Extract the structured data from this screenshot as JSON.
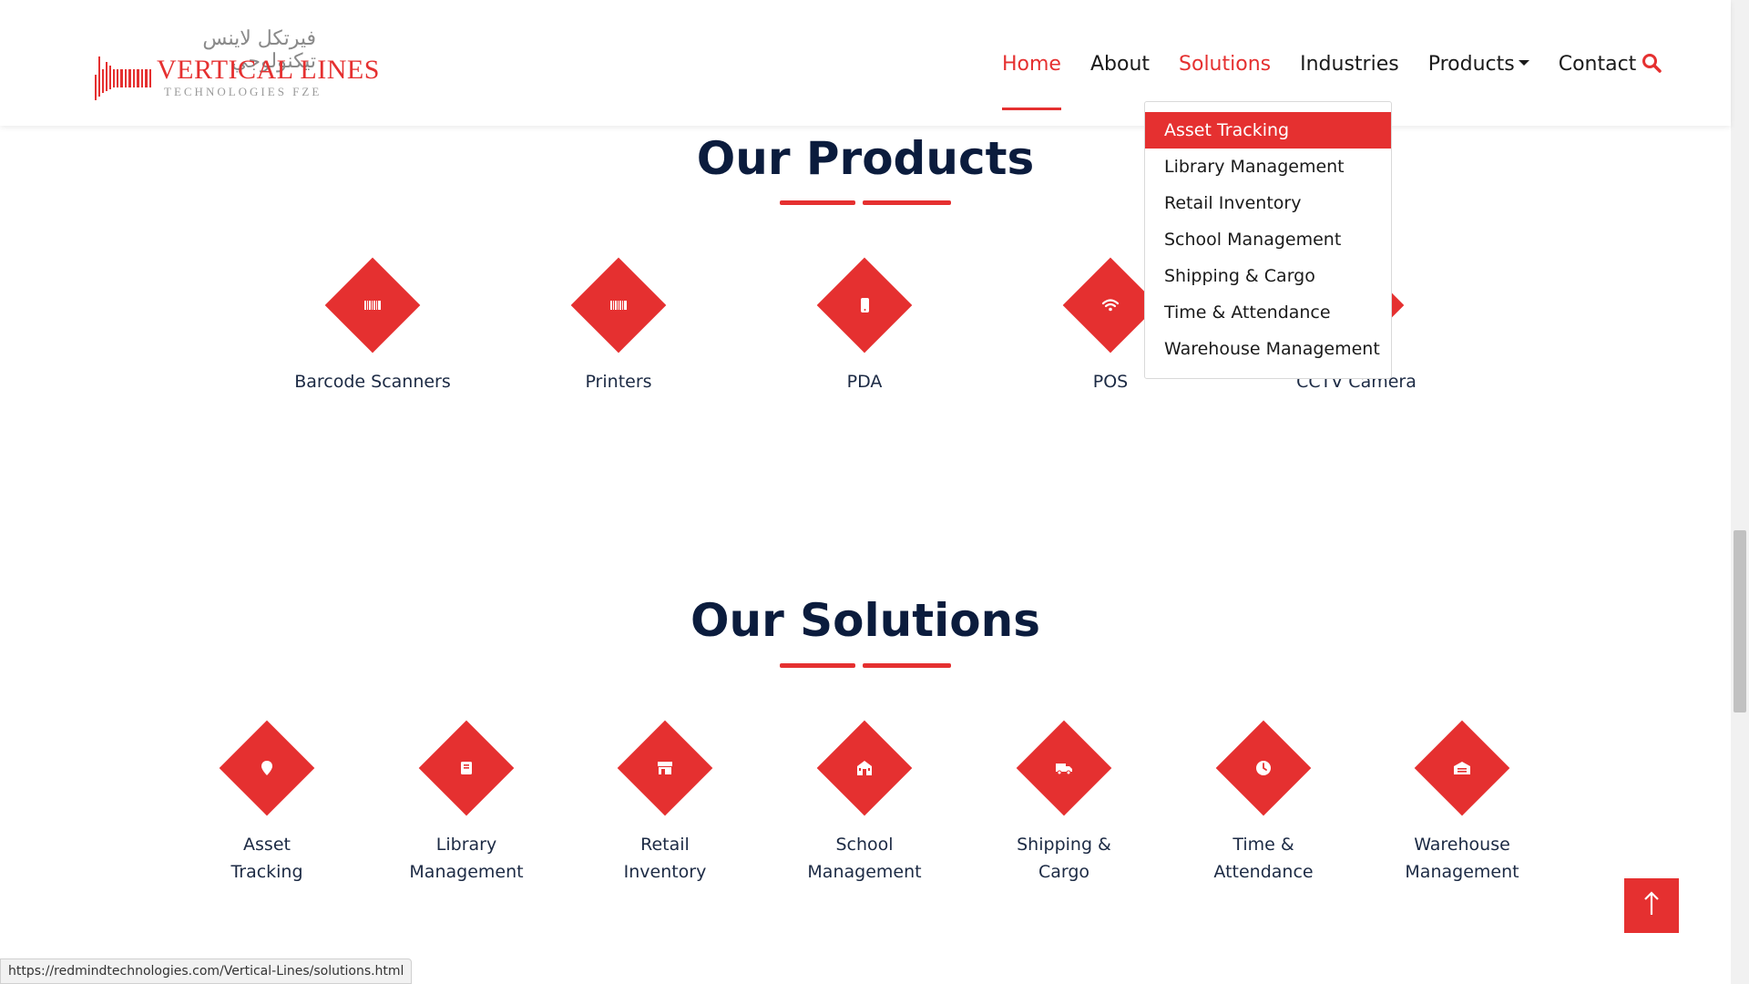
{
  "brand": {
    "arabic": "فيرتكل لاينس تيكنولوجي",
    "name": "VERTICAL LINES",
    "tagline": "TECHNOLOGIES FZE",
    "accent_color": "#e53030",
    "title_color": "#0b1c3d"
  },
  "nav": {
    "items": [
      {
        "label": "Home"
      },
      {
        "label": "About"
      },
      {
        "label": "Solutions"
      },
      {
        "label": "Industries"
      },
      {
        "label": "Products"
      },
      {
        "label": "Contact"
      }
    ],
    "search_icon": "search-icon"
  },
  "solutions_menu": {
    "items": [
      {
        "label": "Asset Tracking"
      },
      {
        "label": "Library Management"
      },
      {
        "label": "Retail Inventory"
      },
      {
        "label": "School Management"
      },
      {
        "label": "Shipping & Cargo"
      },
      {
        "label": "Time & Attendance"
      },
      {
        "label": "Warehouse Management"
      }
    ]
  },
  "products": {
    "title": "Our Products",
    "items": [
      {
        "label": "Barcode Scanners",
        "icon": "barcode-icon"
      },
      {
        "label": "Printers",
        "icon": "barcode-icon"
      },
      {
        "label": "PDA",
        "icon": "mobile-icon"
      },
      {
        "label": "POS",
        "icon": "wifi-icon"
      },
      {
        "label": "CCTV Camera",
        "icon": "camera-icon"
      }
    ]
  },
  "solutions": {
    "title": "Our Solutions",
    "items": [
      {
        "line1": "Asset",
        "line2": "Tracking",
        "icon": "map-pin-icon"
      },
      {
        "line1": "Library",
        "line2": "Management",
        "icon": "book-icon"
      },
      {
        "line1": "Retail",
        "line2": "Inventory",
        "icon": "store-icon"
      },
      {
        "line1": "School",
        "line2": "Management",
        "icon": "school-icon"
      },
      {
        "line1": "Shipping &",
        "line2": "Cargo",
        "icon": "truck-icon"
      },
      {
        "line1": "Time &",
        "line2": "Attendance",
        "icon": "clock-icon"
      },
      {
        "line1": "Warehouse",
        "line2": "Management",
        "icon": "warehouse-icon"
      }
    ]
  },
  "status_bar": {
    "url": "https://redmindtechnologies.com/Vertical-Lines/solutions.html"
  }
}
